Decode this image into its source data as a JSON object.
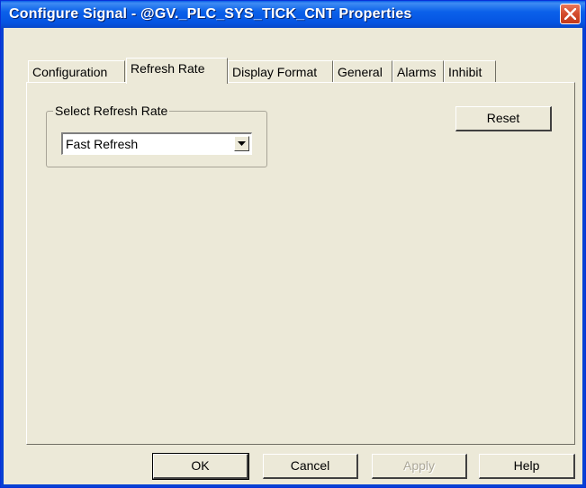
{
  "window": {
    "title": "Configure Signal - @GV._PLC_SYS_TICK_CNT Properties"
  },
  "tabs": [
    {
      "label": "Configuration"
    },
    {
      "label": "Refresh Rate"
    },
    {
      "label": "Display Format"
    },
    {
      "label": "General"
    },
    {
      "label": "Alarms"
    },
    {
      "label": "Inhibit"
    }
  ],
  "active_tab": "Refresh Rate",
  "refresh": {
    "group_label": "Select Refresh Rate",
    "selected": "Fast Refresh",
    "reset_label": "Reset"
  },
  "buttons": {
    "ok": "OK",
    "cancel": "Cancel",
    "apply": "Apply",
    "help": "Help"
  },
  "colors": {
    "title_bar": "#0554e2",
    "face": "#ece9d8",
    "close_button": "#d34b2b"
  },
  "icons": {
    "close": "close-icon",
    "dropdown": "chevron-down-icon"
  }
}
